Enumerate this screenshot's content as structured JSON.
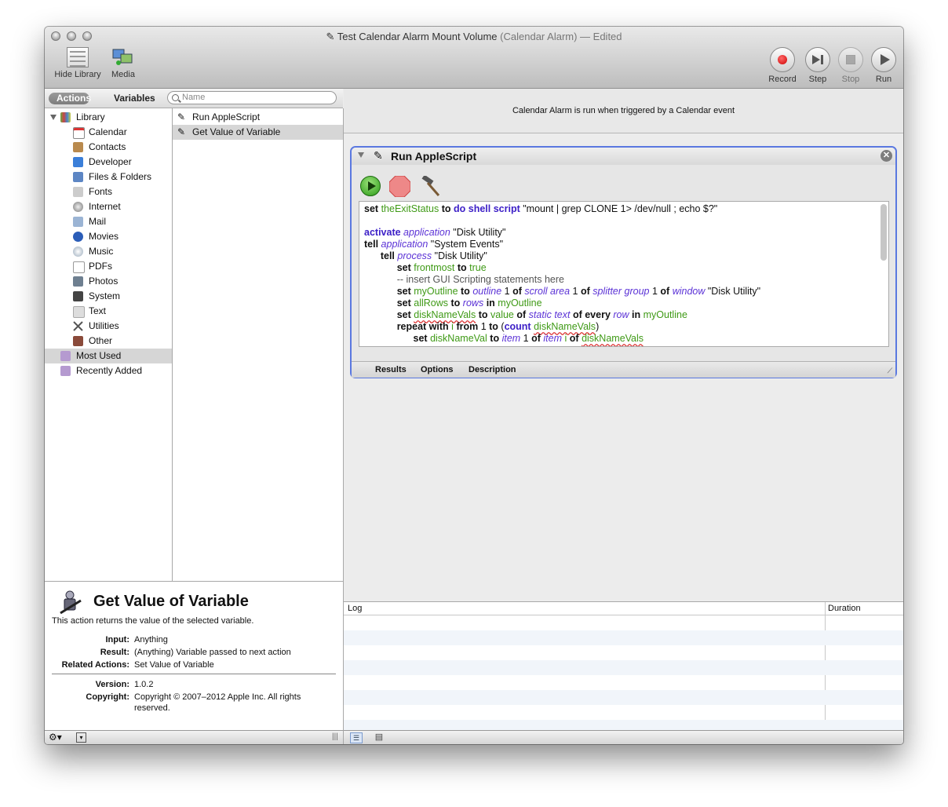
{
  "window": {
    "title": "Test Calendar Alarm Mount Volume",
    "subtitle": "(Calendar Alarm) — Edited"
  },
  "toolbar": {
    "hide_library": "Hide Library",
    "media": "Media",
    "record": "Record",
    "step": "Step",
    "stop": "Stop",
    "run": "Run"
  },
  "library": {
    "tab_actions": "Actions",
    "tab_variables": "Variables",
    "search_placeholder": "Name",
    "root": "Library",
    "categories": [
      "Calendar",
      "Contacts",
      "Developer",
      "Files & Folders",
      "Fonts",
      "Internet",
      "Mail",
      "Movies",
      "Music",
      "PDFs",
      "Photos",
      "System",
      "Text",
      "Utilities",
      "Other"
    ],
    "most_used": "Most Used",
    "recently_added": "Recently Added",
    "actions": [
      "Run AppleScript",
      "Get Value of Variable"
    ]
  },
  "description": {
    "title": "Get Value of Variable",
    "text": "This action returns the value of the selected variable.",
    "input_label": "Input:",
    "input": "Anything",
    "result_label": "Result:",
    "result": "(Anything) Variable passed to next action",
    "related_label": "Related Actions:",
    "related": "Set Value of Variable",
    "version_label": "Version:",
    "version": "1.0.2",
    "copyright_label": "Copyright:",
    "copyright_1": "Copyright © 2007–2012 Apple Inc.  All rights",
    "copyright_2": "reserved."
  },
  "workflow": {
    "banner": "Calendar Alarm is run when triggered by a Calendar event",
    "action_title": "Run AppleScript",
    "tabs": [
      "Results",
      "Options",
      "Description"
    ]
  },
  "log": {
    "col_log": "Log",
    "col_duration": "Duration"
  },
  "colors": {
    "action_border": "#5a78e0",
    "keyword_blue": "#3d20c7",
    "variable_green": "#3f9a16",
    "selected_row": "#d6d6d6"
  }
}
